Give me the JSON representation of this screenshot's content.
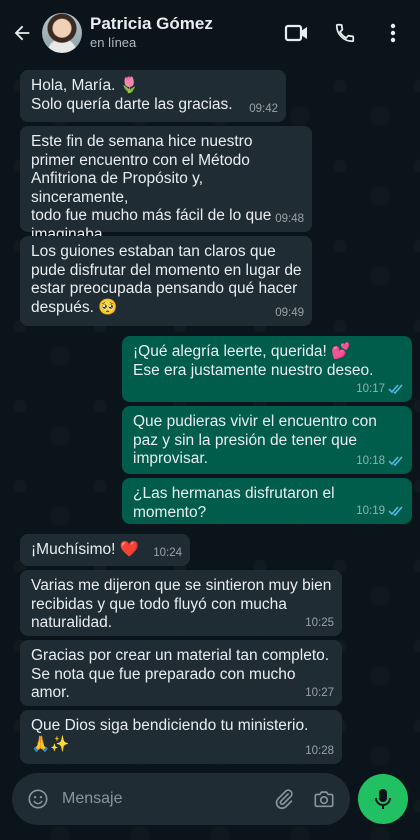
{
  "header": {
    "contact_name": "Patricia Gómez",
    "status": "en línea"
  },
  "messages": [
    {
      "dir": "in",
      "text": "Hola, María. 🌷\nSolo quería darte las gracias.",
      "time": "09:42"
    },
    {
      "dir": "in",
      "text": "Este fin de semana hice nuestro\nprimer encuentro con el Método\nAnfitriona de Propósito y, sinceramente,\ntodo fue mucho más fácil de lo que\nimaginaba.",
      "time": "09:48"
    },
    {
      "dir": "in",
      "text": "Los guiones estaban tan claros que\npude disfrutar del momento en lugar de\nestar preocupada pensando qué hacer\ndespués. 🥺",
      "time": "09:49"
    },
    {
      "dir": "out",
      "text": "¡Qué alegría leerte, querida! 💕\nEse era justamente nuestro deseo.",
      "time": "10:17",
      "read": true
    },
    {
      "dir": "out",
      "text": "Que pudieras vivir el encuentro con\npaz y sin la presión de tener que\nimprovisar.",
      "time": "10:18",
      "read": true
    },
    {
      "dir": "out",
      "text": "¿Las hermanas disfrutaron el momento?",
      "time": "10:19",
      "read": true
    },
    {
      "dir": "in",
      "text": "¡Muchísimo! ❤️",
      "time": "10:24"
    },
    {
      "dir": "in",
      "text": "Varias me dijeron que se sintieron muy bien\nrecibidas y que todo fluyó con mucha\nnaturalidad.",
      "time": "10:25"
    },
    {
      "dir": "in",
      "text": "Gracias por crear un material tan completo.\nSe nota que fue preparado con mucho amor.",
      "time": "10:27"
    },
    {
      "dir": "in",
      "text": "Que Dios siga bendiciendo tu ministerio.\n🙏✨",
      "time": "10:28"
    }
  ],
  "composer": {
    "placeholder": "Mensaje"
  },
  "colors": {
    "background": "#0b141a",
    "incoming_bubble": "#202c33",
    "outgoing_bubble": "#005c4b",
    "read_ticks": "#53bdeb",
    "mic_button": "#21c063"
  },
  "icons": {
    "back": "back-arrow-icon",
    "video": "video-camera-icon",
    "call": "phone-icon",
    "menu": "more-vert-icon",
    "emoji": "emoji-icon",
    "attach": "paperclip-icon",
    "camera": "camera-icon",
    "mic": "microphone-icon"
  }
}
